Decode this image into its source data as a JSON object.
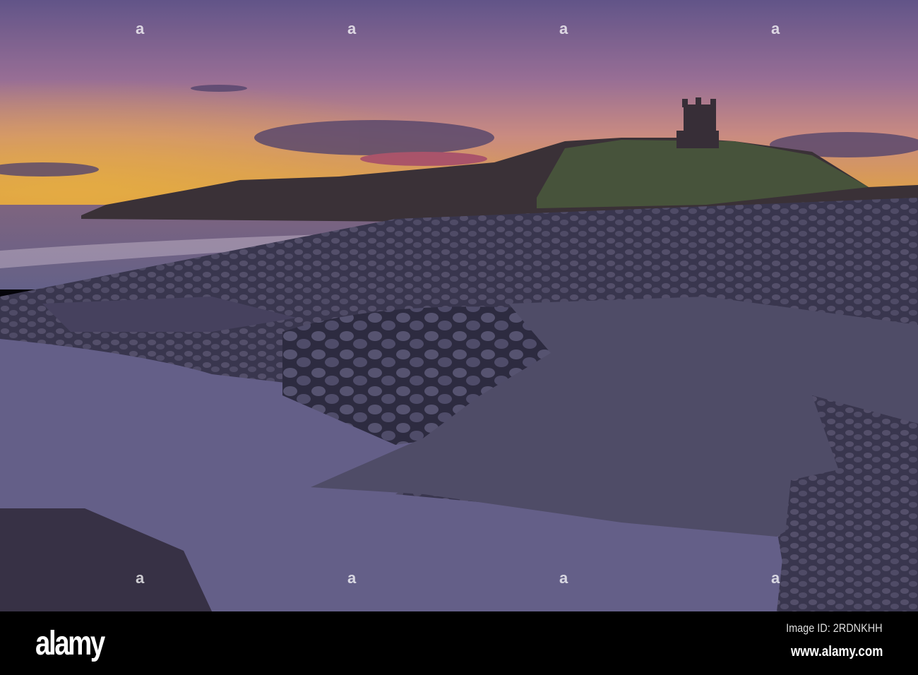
{
  "photo": {
    "subject": "castle-ruin-on-headland-at-sunrise",
    "colors": {
      "sky_top": "#6f5f92",
      "sky_mid": "#c07a9a",
      "horizon": "#f6a630",
      "rocks": "#4a4860",
      "water": "#8c7fa6"
    }
  },
  "footer": {
    "logo": "alamy",
    "image_id": "Image ID: 2RDNKHH",
    "url": "www.alamy.com"
  }
}
